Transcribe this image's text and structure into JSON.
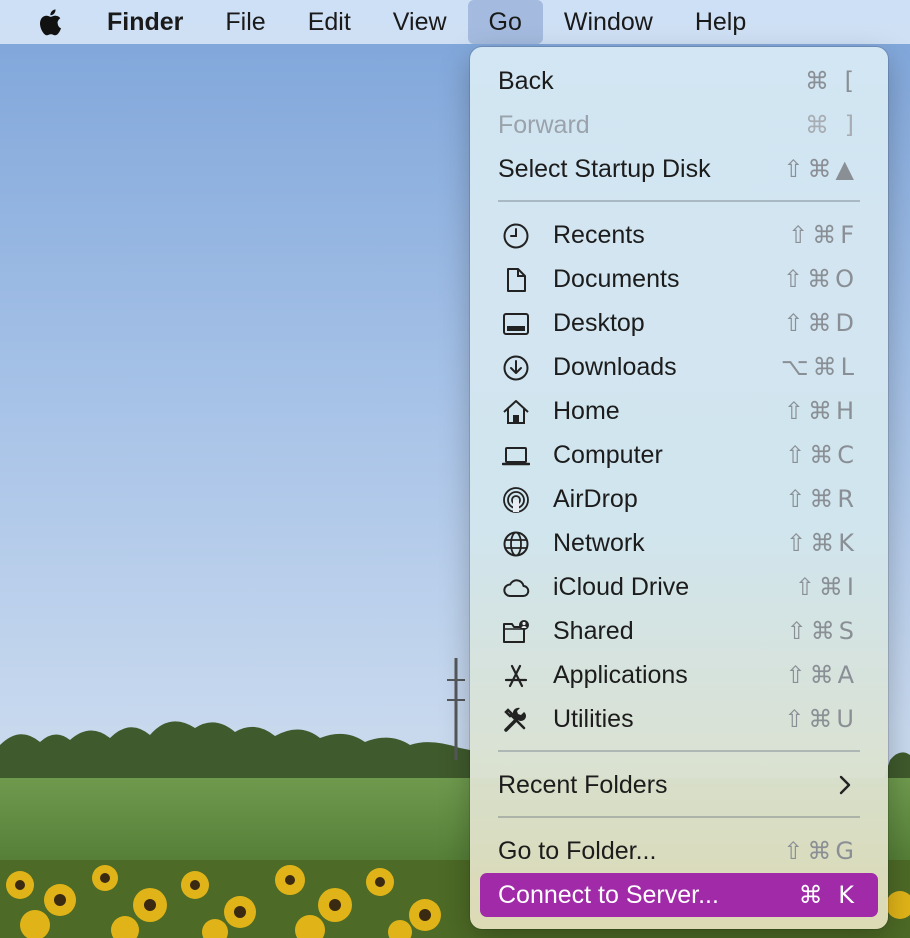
{
  "menubar": {
    "apple_icon": "apple-logo-icon",
    "app_name": "Finder",
    "items": [
      "File",
      "Edit",
      "View",
      "Go",
      "Window",
      "Help"
    ],
    "active_item": "Go"
  },
  "go_menu": {
    "nav_items": [
      {
        "label": "Back",
        "shortcut": "⌘ [",
        "enabled": true
      },
      {
        "label": "Forward",
        "shortcut": "⌘ ]",
        "enabled": false
      },
      {
        "label": "Select Startup Disk",
        "shortcut": "⇧⌘▲",
        "enabled": true
      }
    ],
    "places": [
      {
        "label": "Recents",
        "shortcut": "⇧⌘F",
        "icon": "clock-icon"
      },
      {
        "label": "Documents",
        "shortcut": "⇧⌘O",
        "icon": "document-icon"
      },
      {
        "label": "Desktop",
        "shortcut": "⇧⌘D",
        "icon": "desktop-icon"
      },
      {
        "label": "Downloads",
        "shortcut": "⌥⌘L",
        "icon": "download-icon"
      },
      {
        "label": "Home",
        "shortcut": "⇧⌘H",
        "icon": "home-icon"
      },
      {
        "label": "Computer",
        "shortcut": "⇧⌘C",
        "icon": "laptop-icon"
      },
      {
        "label": "AirDrop",
        "shortcut": "⇧⌘R",
        "icon": "airdrop-icon"
      },
      {
        "label": "Network",
        "shortcut": "⇧⌘K",
        "icon": "globe-icon"
      },
      {
        "label": "iCloud Drive",
        "shortcut": "⇧⌘I",
        "icon": "cloud-icon"
      },
      {
        "label": "Shared",
        "shortcut": "⇧⌘S",
        "icon": "shared-folder-icon"
      },
      {
        "label": "Applications",
        "shortcut": "⇧⌘A",
        "icon": "applications-icon"
      },
      {
        "label": "Utilities",
        "shortcut": "⇧⌘U",
        "icon": "tools-icon"
      }
    ],
    "recent_folders": {
      "label": "Recent Folders",
      "icon": "chevron-right-icon"
    },
    "go_to_folder": {
      "label": "Go to Folder...",
      "shortcut": "⇧⌘G"
    },
    "connect_to_server": {
      "label": "Connect to Server...",
      "shortcut": "⌘ K",
      "highlighted": true
    }
  },
  "colors": {
    "highlight": "#a02aa8",
    "menubar": "#dae8f8",
    "shortcut_text": "#8a8f95"
  }
}
